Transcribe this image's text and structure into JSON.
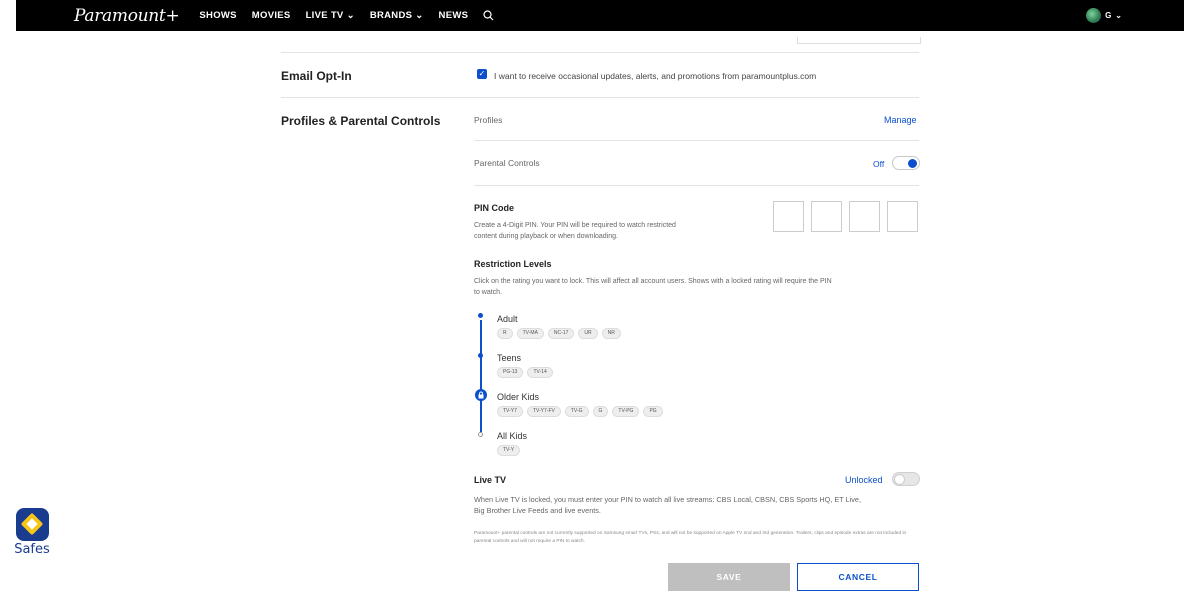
{
  "header": {
    "logo": "Paramount+",
    "nav": [
      {
        "label": "SHOWS",
        "dropdown": false
      },
      {
        "label": "MOVIES",
        "dropdown": false
      },
      {
        "label": "LIVE TV",
        "dropdown": true
      },
      {
        "label": "BRANDS",
        "dropdown": true
      },
      {
        "label": "NEWS",
        "dropdown": false
      }
    ],
    "avatar_initial": "G"
  },
  "email_optin": {
    "title": "Email Opt-In",
    "checked": true,
    "label": "I want to receive occasional updates, alerts, and promotions from paramountplus.com"
  },
  "profiles": {
    "title": "Profiles & Parental Controls",
    "profiles_label": "Profiles",
    "manage_link": "Manage",
    "parental_label": "Parental Controls",
    "parental_state": "Off"
  },
  "pin": {
    "heading": "PIN Code",
    "description_line1": "Create a 4-Digit PIN. Your PIN will be required to watch restricted",
    "description_line2": "content during playback or when downloading."
  },
  "restrictions": {
    "heading": "Restriction Levels",
    "description_line1": "Click on the rating you want to lock. This will affect all account users. Shows with a locked rating will require the PIN",
    "description_line2": "to watch.",
    "levels": [
      {
        "name": "Adult",
        "ratings": [
          "R",
          "TV-MA",
          "NC-17",
          "UR",
          "NR"
        ]
      },
      {
        "name": "Teens",
        "ratings": [
          "PG-13",
          "TV-14"
        ]
      },
      {
        "name": "Older Kids",
        "ratings": [
          "TV-Y7",
          "TV-Y7-FV",
          "TV-G",
          "G",
          "TV-PG",
          "PG"
        ]
      },
      {
        "name": "All Kids",
        "ratings": [
          "TV-Y"
        ]
      }
    ]
  },
  "live_tv": {
    "heading": "Live TV",
    "state": "Unlocked",
    "description_line1": "When Live TV is locked, you must enter your PIN to watch all live streams: CBS Local, CBSN, CBS Sports HQ, ET Live,",
    "description_line2": "Big Brother Live Feeds and live events."
  },
  "fine_print": "Paramount+ parental controls are not currently supported on Samsung smart TVs, PS4, and will not be supported on Apple TV 2nd and 3rd generation. Trailers, clips and episode extras are not included in parental controls and will not require a PIN to watch.",
  "actions": {
    "save": "SAVE",
    "cancel": "CANCEL"
  },
  "watermark": {
    "label": "Safes"
  },
  "colors": {
    "accent": "#0b4fcc",
    "topbar": "#000000",
    "save_disabled": "#bfbfbf"
  }
}
